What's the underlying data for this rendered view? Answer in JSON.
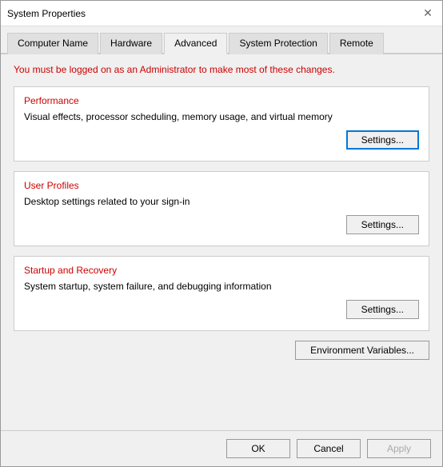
{
  "window": {
    "title": "System Properties",
    "close_label": "✕"
  },
  "tabs": [
    {
      "id": "computer-name",
      "label": "Computer Name",
      "active": false
    },
    {
      "id": "hardware",
      "label": "Hardware",
      "active": false
    },
    {
      "id": "advanced",
      "label": "Advanced",
      "active": true
    },
    {
      "id": "system-protection",
      "label": "System Protection",
      "active": false
    },
    {
      "id": "remote",
      "label": "Remote",
      "active": false
    }
  ],
  "content": {
    "admin_notice": "You must be logged on as an Administrator to make most of these changes.",
    "performance": {
      "title": "Performance",
      "description": "Visual effects, processor scheduling, memory usage, and virtual memory",
      "settings_label": "Settings..."
    },
    "user_profiles": {
      "title": "User Profiles",
      "description": "Desktop settings related to your sign-in",
      "settings_label": "Settings..."
    },
    "startup_recovery": {
      "title": "Startup and Recovery",
      "description": "System startup, system failure, and debugging information",
      "settings_label": "Settings..."
    },
    "env_variables_label": "Environment Variables..."
  },
  "footer": {
    "ok_label": "OK",
    "cancel_label": "Cancel",
    "apply_label": "Apply"
  }
}
